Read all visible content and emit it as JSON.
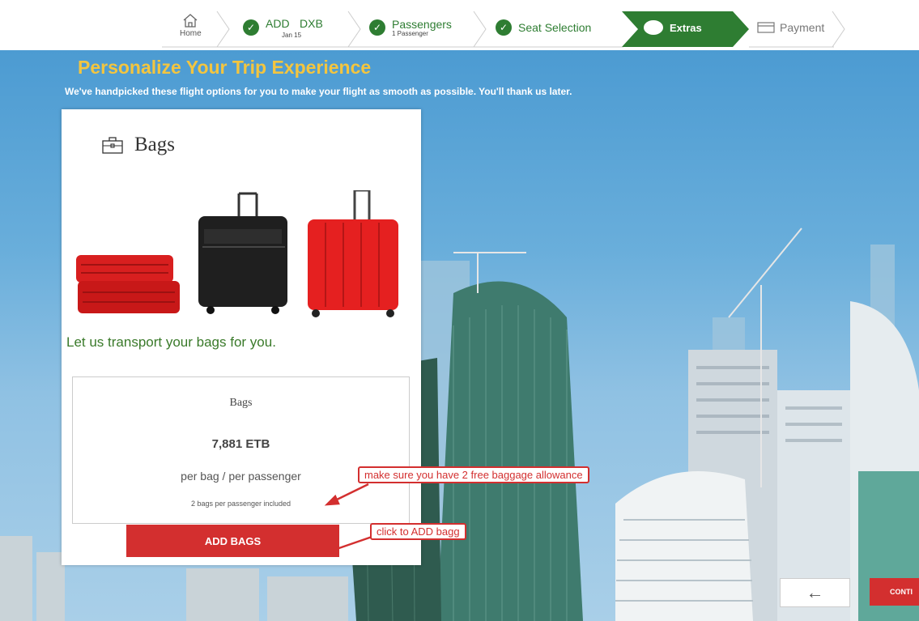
{
  "stepper": {
    "home": {
      "label": "Home",
      "icon": "home-icon"
    },
    "route": {
      "origin": "ADD",
      "destination": "DXB",
      "date": "Jan 15"
    },
    "passengers": {
      "label": "Passengers",
      "sub": "1 Passenger"
    },
    "seat": {
      "label": "Seat Selection"
    },
    "extras": {
      "label": "Extras"
    },
    "payment": {
      "label": "Payment",
      "icon": "card-icon"
    },
    "colors": {
      "done": "#2e7d32",
      "active": "#2e7d32"
    }
  },
  "hero": {
    "title": "Personalize Your Trip Experience",
    "subtitle": "We've handpicked these flight options for you to make your flight as smooth as possible. You'll thank us later."
  },
  "card": {
    "title": "Bags",
    "icon": "briefcase-icon",
    "tagline": "Let us transport your bags for you.",
    "price_box": {
      "title": "Bags",
      "price": "7,881  ETB",
      "per": "per bag / per passenger",
      "included": "2 bags per passenger included"
    },
    "add_button": "ADD BAGS"
  },
  "annotations": {
    "allowance": "make sure you have 2 free baggage allowance",
    "click": "click to ADD bagg"
  },
  "nav": {
    "back_icon": "arrow-left-icon",
    "continue": "CONTI"
  },
  "colors": {
    "accent": "#d32f2f",
    "title_yellow": "#f3c53f",
    "green": "#2e7d32"
  }
}
